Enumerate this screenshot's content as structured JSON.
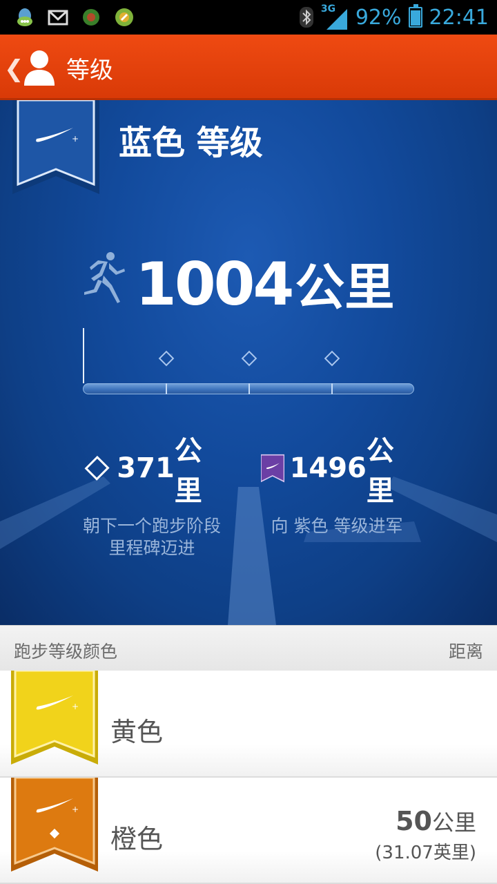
{
  "status_bar": {
    "signal": "3G",
    "battery_percent": "92%",
    "battery_level": 0.92,
    "time": "22:41",
    "icons": [
      "qq-icon",
      "gmail-icon",
      "android-app-icon",
      "app-icon",
      "bluetooth-icon",
      "signal-icon",
      "battery-icon"
    ]
  },
  "action_bar": {
    "title": "等级"
  },
  "hero": {
    "level_title": "蓝色 等级",
    "distance_value": "1004",
    "distance_unit": "公里",
    "next_milestone": {
      "value": "371",
      "unit": "公里",
      "description": "朝下一个跑步阶段里程碑迈进"
    },
    "next_level": {
      "value": "1496",
      "unit": "公里",
      "description": "向 紫色 等级进军"
    }
  },
  "list": {
    "header_left": "跑步等级颜色",
    "header_right": "距离",
    "rows": [
      {
        "name": "黄色",
        "km": "",
        "km_unit": "",
        "miles": ""
      },
      {
        "name": "橙色",
        "km": "50",
        "km_unit": "公里",
        "miles": "(31.07英里)"
      }
    ]
  },
  "colors": {
    "action_bar": "#e5420c",
    "hero_blue": "#124a9c",
    "level_yellow": "#f1d31b",
    "level_orange": "#dd7a10",
    "level_purple": "#6b3fa5"
  }
}
